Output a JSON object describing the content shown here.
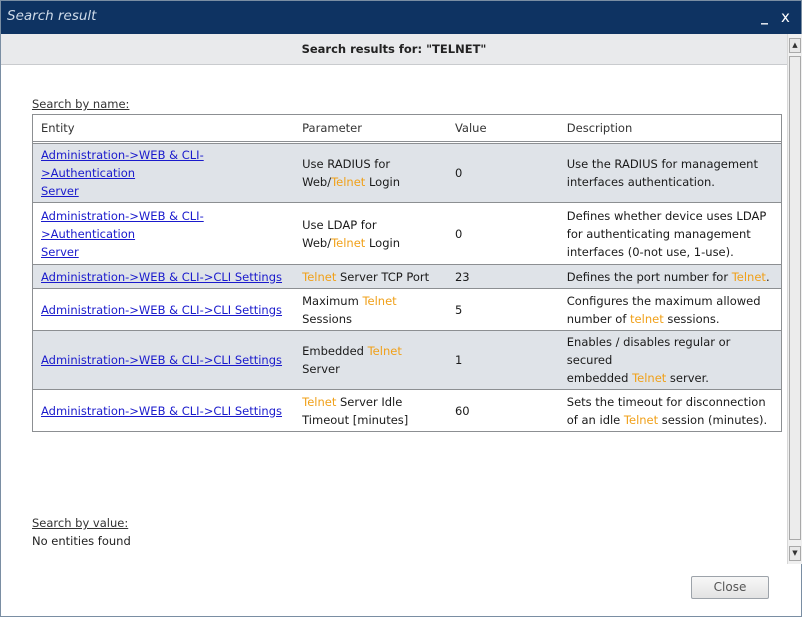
{
  "window": {
    "title": "Search result",
    "minimize_glyph": "_",
    "close_glyph": "x"
  },
  "header": {
    "text": "Search results for: \"TELNET\""
  },
  "search_by_name": {
    "label": "Search by name:",
    "columns": [
      "Entity",
      "Parameter",
      "Value",
      "Description"
    ],
    "rows": [
      {
        "entity_line1": "Administration->WEB & CLI->Authentication",
        "entity_line2": "Server",
        "param": [
          "Use RADIUS for",
          "Web/",
          "Telnet",
          " Login"
        ],
        "value": "0",
        "desc": [
          "Use the RADIUS for management",
          "interfaces authentication."
        ]
      },
      {
        "entity_line1": "Administration->WEB & CLI->Authentication",
        "entity_line2": "Server",
        "param": [
          "Use LDAP for",
          "Web/",
          "Telnet",
          " Login"
        ],
        "value": "0",
        "desc": [
          "Defines whether device uses LDAP",
          "for authenticating management",
          "interfaces (0-not use, 1-use)."
        ]
      },
      {
        "entity_line1": "Administration->WEB & CLI->CLI Settings",
        "param": [
          "Telnet",
          " Server TCP Port"
        ],
        "value": "23",
        "desc": [
          "Defines the port number for ",
          "Telnet",
          "."
        ]
      },
      {
        "entity_line1": "Administration->WEB & CLI->CLI Settings",
        "param": [
          "Maximum ",
          "Telnet",
          "Sessions"
        ],
        "value": "5",
        "desc": [
          "Configures the maximum allowed",
          "number of ",
          "telnet",
          " sessions."
        ]
      },
      {
        "entity_line1": "Administration->WEB & CLI->CLI Settings",
        "param": [
          "Embedded ",
          "Telnet",
          "Server"
        ],
        "value": "1",
        "desc": [
          "Enables / disables regular or secured",
          "embedded ",
          "Telnet",
          " server."
        ]
      },
      {
        "entity_line1": "Administration->WEB & CLI->CLI Settings",
        "param": [
          "Telnet",
          " Server Idle",
          "Timeout [minutes]"
        ],
        "value": "60",
        "desc": [
          "Sets the timeout for disconnection",
          "of an idle ",
          "Telnet",
          " session (minutes)."
        ]
      }
    ]
  },
  "search_by_value": {
    "label": "Search by value:",
    "result": "No entities found"
  },
  "footer": {
    "close_label": "Close"
  },
  "colors": {
    "title_bar": "#0e3362",
    "keyword_highlight": "#f0a019",
    "link": "#1a1acc",
    "odd_row": "#dfe3e8"
  }
}
